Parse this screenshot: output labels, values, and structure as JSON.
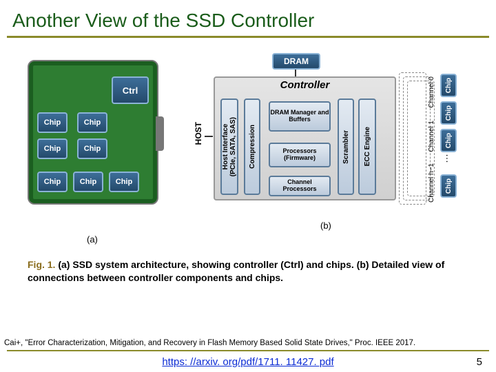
{
  "title": "Another View of the SSD Controller",
  "figure": {
    "a": {
      "ctrl_label": "Ctrl",
      "chip_label": "Chip",
      "sublabel": "(a)"
    },
    "b": {
      "dram": "DRAM",
      "controller": "Controller",
      "host_interface": "Host Interface\n(PCIe, SATA, SAS)",
      "compression": "Compression",
      "dram_manager": "DRAM Manager and Buffers",
      "processors": "Processors (Firmware)",
      "channel_processors": "Channel Processors",
      "scrambler": "Scrambler",
      "ecc": "ECC Engine",
      "host_label": "HOST",
      "channels": [
        "Channel 0",
        "Channel 1",
        "Channel h−1"
      ],
      "chip_label": "Chip",
      "ellipsis": "…",
      "sublabel": "(b)"
    }
  },
  "caption": {
    "prefix": "Fig. 1.",
    "text_a": "(a) SSD system architecture, showing controller (Ctrl) and chips.",
    "text_b": "(b) Detailed view of connections between controller components and chips."
  },
  "citation": "Cai+, \"Error Characterization, Mitigation, and Recovery in Flash Memory Based Solid State Drives,\" Proc. IEEE 2017.",
  "link": "https: //arxiv. org/pdf/1711. 11427. pdf",
  "page": "5"
}
